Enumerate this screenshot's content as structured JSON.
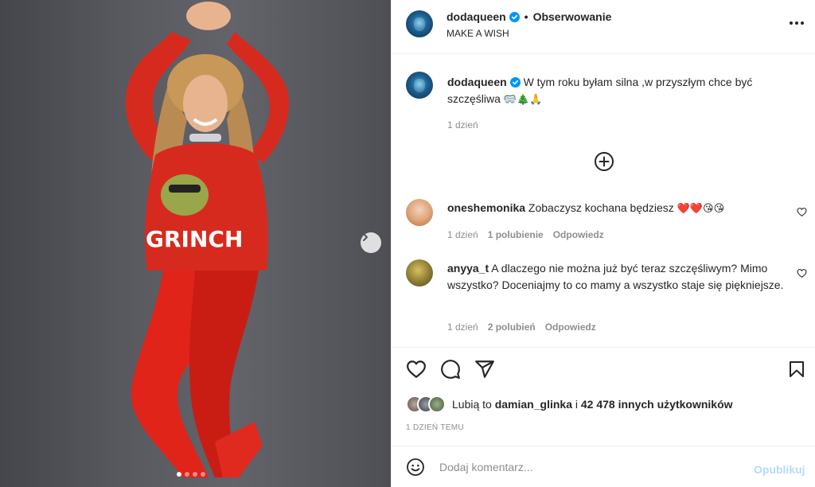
{
  "post": {
    "username": "dodaqueen",
    "verified": true,
    "follow_label": "Obserwowanie",
    "separator": "•",
    "subtitle": "MAKE A WISH",
    "caption": {
      "text": "W tym roku byłam silna ,w przyszłym chce być szczęśliwa",
      "emojis": "🥽🎄🙏",
      "time": "1 dzień"
    },
    "media": {
      "carousel_count": 4,
      "active_index": 0,
      "sweater_text": "GRINCH"
    }
  },
  "comments": [
    {
      "username": "oneshemonika",
      "text": "Zobaczysz kochana będziesz",
      "emojis": "❤️❤️😘😘",
      "time": "1 dzień",
      "likes": "1 polubienie",
      "reply": "Odpowiedz"
    },
    {
      "username": "anyya_t",
      "text": "A dlaczego nie można już być teraz szczęśliwym? Mimo wszystko? Doceniajmy to co mamy a wszystko staje się piękniejsze.",
      "time": "1 dzień",
      "likes": "2 polubień",
      "reply": "Odpowiedz"
    }
  ],
  "likes": {
    "prefix": "Lubią to",
    "user": "damian_glinka",
    "connector": "i",
    "others": "42 478 innych użytkowników"
  },
  "timestamp": "1 dzień temu",
  "add_comment": {
    "placeholder": "Dodaj komentarz...",
    "publish_label": "Opublikuj"
  },
  "colors": {
    "verified": "#0095f6",
    "publish_disabled": "#b3dbff",
    "text": "#262626",
    "muted": "#8e8e8e",
    "heart_red": "#ed4956"
  },
  "icons": [
    "chevron-right-icon",
    "more-icon",
    "plus-circle-icon",
    "heart-icon",
    "comment-icon",
    "share-icon",
    "bookmark-icon",
    "emoji-icon",
    "verified-icon"
  ]
}
